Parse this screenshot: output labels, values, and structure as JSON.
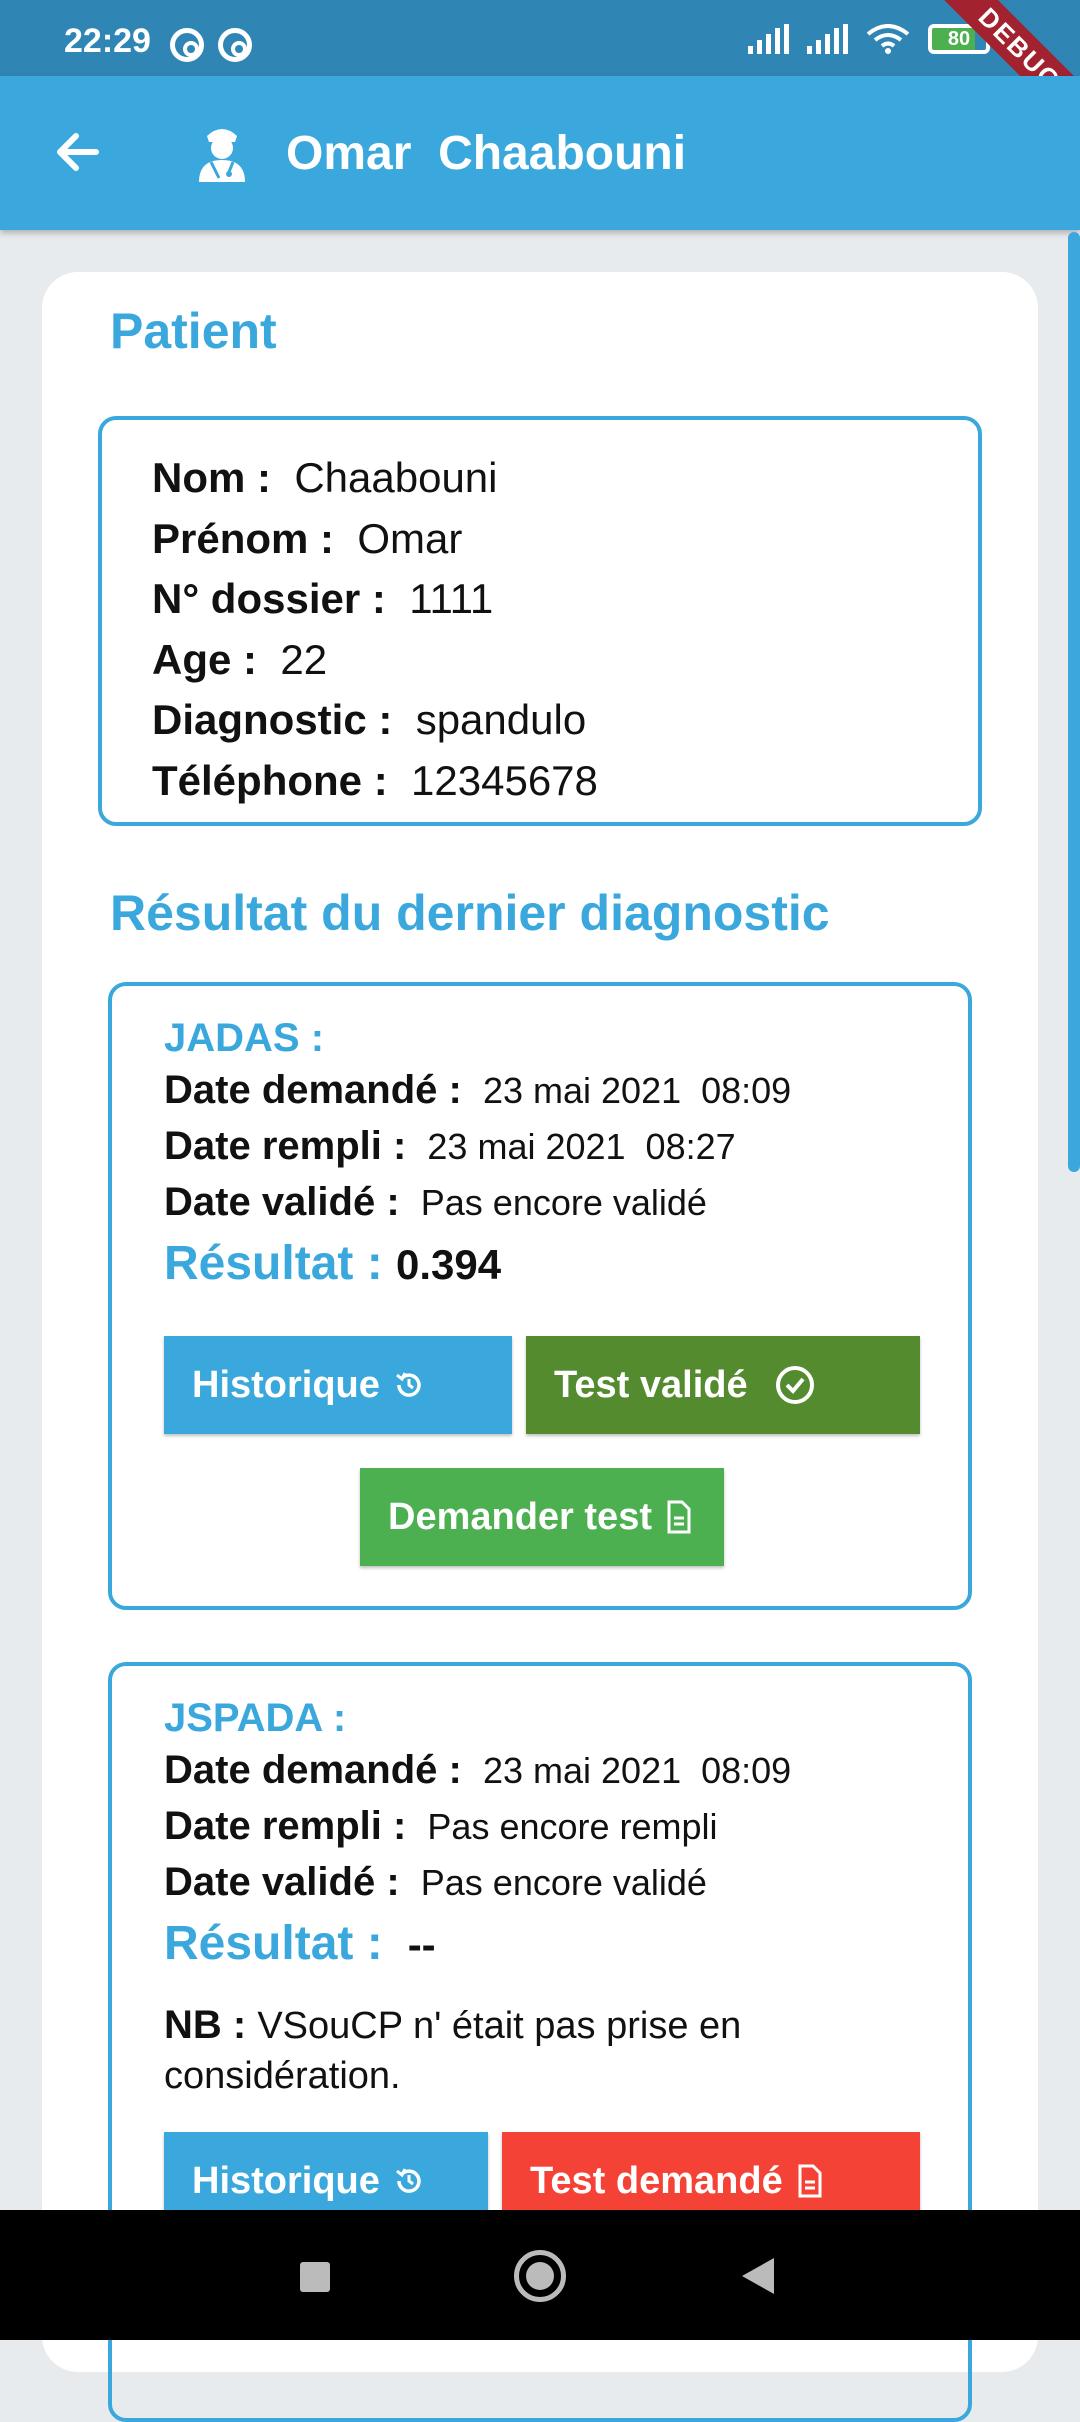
{
  "status_bar": {
    "time": "22:29",
    "battery": "80",
    "debug_label": "DEBUG"
  },
  "app_bar": {
    "title": "Omar  Chaabouni",
    "back_icon": "arrow-left-icon",
    "avatar_icon": "doctor-icon"
  },
  "patient": {
    "section_title": "Patient",
    "fields": [
      {
        "label": "Nom : ",
        "value": " Chaabouni"
      },
      {
        "label": "Prénom : ",
        "value": " Omar"
      },
      {
        "label": "N° dossier : ",
        "value": " 1111"
      },
      {
        "label": "Age : ",
        "value": " 22"
      },
      {
        "label": "Diagnostic : ",
        "value": " spandulo"
      },
      {
        "label": "Téléphone : ",
        "value": " 12345678"
      }
    ]
  },
  "results": {
    "section_title": "Résultat du dernier diagnostic",
    "tests": [
      {
        "name": "JADAS :",
        "date_demande_label": "Date demandé : ",
        "date_demande": " 23 mai 2021  08:09",
        "date_rempli_label": "Date rempli : ",
        "date_rempli": " 23 mai 2021  08:27",
        "date_valide_label": "Date validé : ",
        "date_valide": " Pas encore validé",
        "resultat_label": "Résultat : ",
        "resultat": "0.394",
        "btn_historique": "Historique",
        "btn_status": "Test validé",
        "btn_demander": "Demander test"
      },
      {
        "name": "JSPADA :",
        "date_demande_label": "Date demandé : ",
        "date_demande": " 23 mai 2021  08:09",
        "date_rempli_label": "Date rempli : ",
        "date_rempli": " Pas encore rempli",
        "date_valide_label": "Date validé : ",
        "date_valide": " Pas encore validé",
        "resultat_label": "Résultat : ",
        "resultat": " --",
        "nb_label": "NB : ",
        "nb_text": "VSouCP n' était pas prise en considération.",
        "btn_historique": "Historique",
        "btn_status": "Test demandé"
      }
    ]
  },
  "colors": {
    "primary": "#3aa8dc",
    "validated": "#558b2f",
    "request": "#4caf50",
    "pending": "#f44336"
  }
}
